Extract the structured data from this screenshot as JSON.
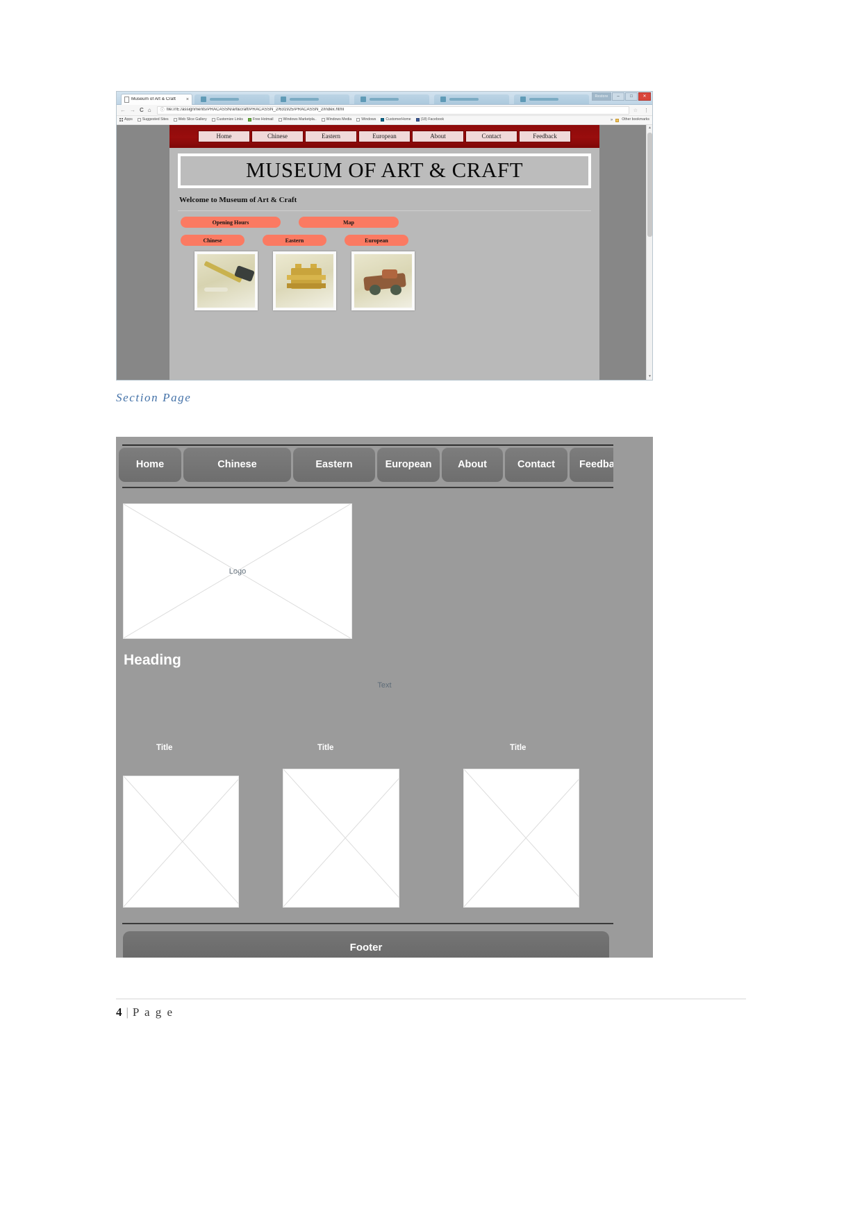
{
  "document": {
    "caption": "Section Page",
    "page_footer": {
      "number": "4",
      "separator": "|",
      "label": "P a g e"
    }
  },
  "browser": {
    "tab": {
      "title": "Museum of Art & Craft",
      "close": "×",
      "favicon": "page-icon"
    },
    "window_controls": {
      "restore_label": "Restore",
      "minimize": "–",
      "maximize": "□",
      "close": "✕"
    },
    "toolbar": {
      "back": "←",
      "forward": "→",
      "reload": "C",
      "home": "⌂",
      "info": "ⓘ",
      "url": "file:///E:/assignments/PRACASSN/art&craft/PRACASSN_2/631925/PRACASSN_2/index.html",
      "star": "☆",
      "menu": "⋮"
    },
    "bookmarks": [
      {
        "label": "Apps",
        "icon": "apps-grid-icon"
      },
      {
        "label": "Suggested Sites",
        "icon": "page-icon"
      },
      {
        "label": "Web Slice Gallery",
        "icon": "page-icon"
      },
      {
        "label": "Customize Links",
        "icon": "page-icon"
      },
      {
        "label": "Free Hotmail",
        "icon": "windows-icon"
      },
      {
        "label": "Windows Marketpla..",
        "icon": "page-icon"
      },
      {
        "label": "Windows Media",
        "icon": "page-icon"
      },
      {
        "label": "Windows",
        "icon": "page-icon"
      },
      {
        "label": "CustomerHome",
        "icon": "teal-site-icon"
      },
      {
        "label": "(18) Facebook",
        "icon": "facebook-icon"
      }
    ],
    "bookmarks_overflow": "»",
    "other_bookmarks": {
      "label": "Other bookmarks",
      "icon": "folder-icon"
    }
  },
  "site": {
    "nav": [
      "Home",
      "Chinese",
      "Eastern",
      "European",
      "About",
      "Contact",
      "Feedback"
    ],
    "title": "MUSEUM OF ART & CRAFT",
    "welcome": "Welcome to Museum of Art & Craft",
    "pills_row1": [
      "Opening Hours",
      "Map"
    ],
    "pills_row2": [
      "Chinese",
      "Eastern",
      "European"
    ],
    "thumbnails": [
      "craft-photo-hammer",
      "craft-photo-gold-figure",
      "craft-photo-toy-car"
    ],
    "colors": {
      "nav_bar": "#990d0d",
      "pill": "#fb7a62",
      "page_bg": "#b9b9b9",
      "browser_bg": "#878787"
    }
  },
  "wireframe": {
    "nav": [
      "Home",
      "Chinese",
      "Eastern",
      "European",
      "About",
      "Contact",
      "Feedback"
    ],
    "logo_placeholder": "Logo",
    "heading": "Heading",
    "text": "Text",
    "section_titles": [
      "Title",
      "Title",
      "Title"
    ],
    "footer": "Footer",
    "colors": {
      "background": "#9b9b9b",
      "button": "#717171",
      "placeholder": "#ffffff"
    }
  }
}
